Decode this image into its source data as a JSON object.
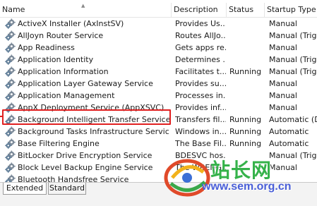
{
  "columns": {
    "name": "Name",
    "description": "Description",
    "status": "Status",
    "startup_type": "Startup Type"
  },
  "services": [
    {
      "name": "ActiveX Installer (AxInstSV)",
      "description": "Provides Us...",
      "status": "",
      "startup": "Manual"
    },
    {
      "name": "AllJoyn Router Service",
      "description": "Routes AllJo...",
      "status": "",
      "startup": "Manual (Trig..."
    },
    {
      "name": "App Readiness",
      "description": "Gets apps re...",
      "status": "",
      "startup": "Manual"
    },
    {
      "name": "Application Identity",
      "description": "Determines ...",
      "status": "",
      "startup": "Manual (Trig..."
    },
    {
      "name": "Application Information",
      "description": "Facilitates t...",
      "status": "Running",
      "startup": "Manual (Trig..."
    },
    {
      "name": "Application Layer Gateway Service",
      "description": "Provides su...",
      "status": "",
      "startup": "Manual"
    },
    {
      "name": "Application Management",
      "description": "Processes in...",
      "status": "",
      "startup": "Manual"
    },
    {
      "name": "AppX Deployment Service (AppXSVC)",
      "description": "Provides inf...",
      "status": "",
      "startup": "Manual"
    },
    {
      "name": "Background Intelligent Transfer Service",
      "description": "Transfers fil...",
      "status": "Running",
      "startup": "Automatic (D..."
    },
    {
      "name": "Background Tasks Infrastructure Service",
      "description": "Windows in...",
      "status": "Running",
      "startup": "Automatic"
    },
    {
      "name": "Base Filtering Engine",
      "description": "The Base Fil...",
      "status": "Running",
      "startup": "Automatic"
    },
    {
      "name": "BitLocker Drive Encryption Service",
      "description": "BDESVC hos...",
      "status": "",
      "startup": "Manual (Trig..."
    },
    {
      "name": "Block Level Backup Engine Service",
      "description": "The WBENG...",
      "status": "",
      "startup": "Manual"
    },
    {
      "name": "Bluetooth Handsfree Service",
      "description": "",
      "status": "",
      "startup": ""
    }
  ],
  "tabs": {
    "extended": "Extended",
    "standard": "Standard"
  },
  "watermark": {
    "chinese": "站长网",
    "url": "www.sem.org.cn"
  },
  "colors": {
    "highlight_border": "#e02020",
    "watermark_green": "#35b24a",
    "watermark_blue": "#4a5fd8"
  }
}
